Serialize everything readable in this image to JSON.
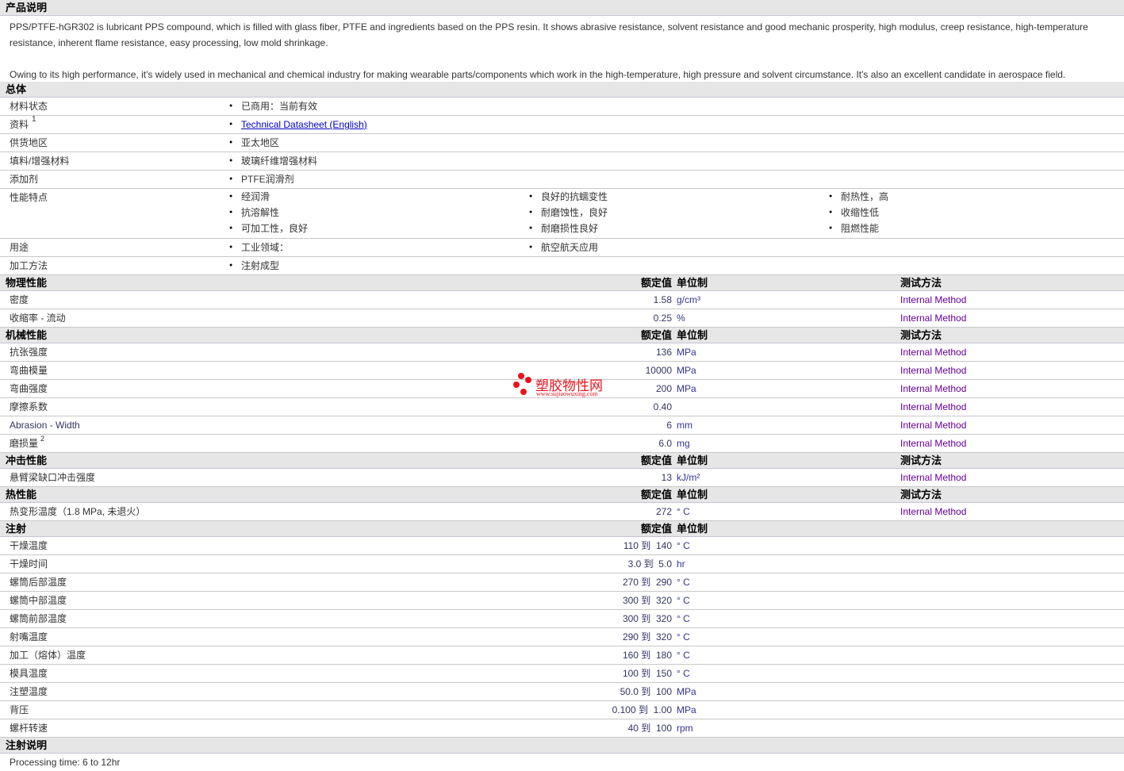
{
  "description": {
    "title": "产品说明",
    "para1": "PPS/PTFE-hGR302 is lubricant PPS compound, which is filled with glass fiber, PTFE and ingredients based on the PPS resin. It shows abrasive resistance, solvent resistance and good mechanic prosperity, high modulus, creep resistance, high-temperature resistance, inherent flame resistance, easy processing, low mold shrinkage.",
    "para2": "Owing to its high performance, it's widely used in mechanical and chemical industry for making wearable parts/components which work in the high-temperature, high pressure and solvent circumstance. It's also an excellent candidate in aerospace field."
  },
  "general": {
    "title": "总体",
    "rows": [
      {
        "label": "材料状态",
        "items": [
          [
            "已商用：当前有效"
          ]
        ]
      },
      {
        "label": "资料",
        "sup": "1",
        "link": "Technical Datasheet (English)"
      },
      {
        "label": "供货地区",
        "items": [
          [
            "亚太地区"
          ]
        ]
      },
      {
        "label": "填料/增强材料",
        "items": [
          [
            "玻璃纤维增强材料"
          ]
        ]
      },
      {
        "label": "添加剂",
        "items": [
          [
            "PTFE润滑剂"
          ]
        ]
      },
      {
        "label": "性能特点",
        "items": [
          [
            "经润滑",
            "抗溶解性",
            "可加工性，良好"
          ],
          [
            "良好的抗蠕变性",
            "耐磨蚀性，良好",
            "耐磨损性良好"
          ],
          [
            "耐热性，高",
            "收缩性低",
            "阻燃性能"
          ]
        ]
      },
      {
        "label": "用途",
        "items": [
          [
            "工业领域："
          ],
          [
            "航空航天应用"
          ]
        ]
      },
      {
        "label": "加工方法",
        "items": [
          [
            "注射成型"
          ]
        ]
      }
    ]
  },
  "headers": {
    "value": "额定值",
    "unit": "单位制",
    "method": "测试方法"
  },
  "sections": [
    {
      "title": "物理性能",
      "method": true,
      "rows": [
        {
          "label": "密度",
          "value": "1.58",
          "unit": "g/cm³",
          "method": "Internal Method"
        },
        {
          "label": "收缩率 - 流动",
          "value": "0.25",
          "unit": "%",
          "method": "Internal Method"
        }
      ]
    },
    {
      "title": "机械性能",
      "method": true,
      "rows": [
        {
          "label": "抗张强度",
          "value": "136",
          "unit": "MPa",
          "method": "Internal Method"
        },
        {
          "label": "弯曲模量",
          "value": "10000",
          "unit": "MPa",
          "method": "Internal Method"
        },
        {
          "label": "弯曲强度",
          "value": "200",
          "unit": "MPa",
          "method": "Internal Method"
        },
        {
          "label": "摩擦系数",
          "value": "0.40",
          "unit": "",
          "method": "Internal Method"
        },
        {
          "label": "Abrasion - Width",
          "value": "6",
          "unit": "mm",
          "method": "Internal Method"
        },
        {
          "label": "磨损量",
          "sup": "2",
          "value": "6.0",
          "unit": "mg",
          "method": "Internal Method"
        }
      ]
    },
    {
      "title": "冲击性能",
      "method": true,
      "rows": [
        {
          "label": "悬臂梁缺口冲击强度",
          "value": "13",
          "unit": "kJ/m²",
          "method": "Internal Method"
        }
      ]
    },
    {
      "title": "热性能",
      "method": true,
      "rows": [
        {
          "label": "热变形温度（1.8 MPa, 未退火）",
          "value": "272",
          "unit": "° C",
          "method": "Internal Method"
        }
      ]
    },
    {
      "title": "注射",
      "method": false,
      "rows": [
        {
          "label": "干燥温度",
          "value": "110 到  140",
          "unit": "° C"
        },
        {
          "label": "干燥时间",
          "value": "3.0 到  5.0",
          "unit": "hr"
        },
        {
          "label": "螺筒后部温度",
          "value": "270 到  290",
          "unit": "° C"
        },
        {
          "label": "螺筒中部温度",
          "value": "300 到  320",
          "unit": "° C"
        },
        {
          "label": "螺筒前部温度",
          "value": "300 到  320",
          "unit": "° C"
        },
        {
          "label": "射嘴温度",
          "value": "290 到  320",
          "unit": "° C"
        },
        {
          "label": "加工（熔体）温度",
          "value": "160 到  180",
          "unit": "° C"
        },
        {
          "label": "模具温度",
          "value": "100 到  150",
          "unit": "° C"
        },
        {
          "label": "注塑温度",
          "value": "50.0 到  100",
          "unit": "MPa"
        },
        {
          "label": "背压",
          "value": "0.100 到  1.00",
          "unit": "MPa"
        },
        {
          "label": "螺杆转速",
          "value": "40 到  100",
          "unit": "rpm"
        }
      ]
    }
  ],
  "notes": {
    "title": "注射说明",
    "text": "Processing time: 6 to 12hr"
  },
  "watermark": {
    "name": "塑胶物性网",
    "url": "www.sujiaowuxing.com"
  }
}
